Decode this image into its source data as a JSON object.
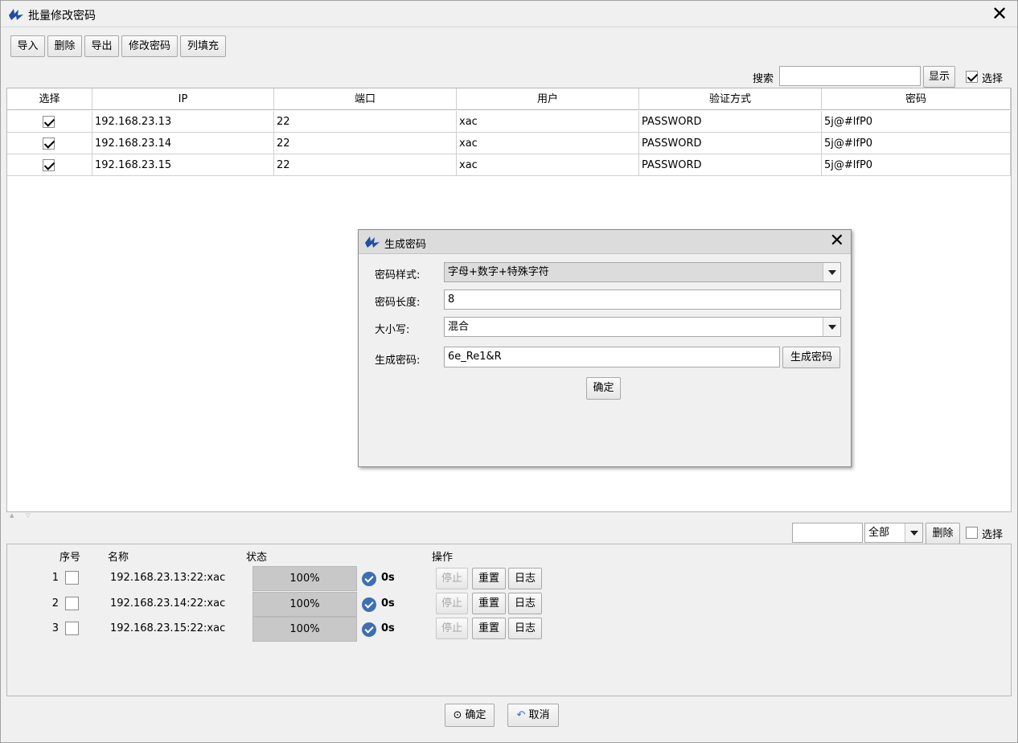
{
  "window": {
    "title": "批量修改密码"
  },
  "toolbar": {
    "import": "导入",
    "delete": "删除",
    "export": "导出",
    "change_password": "修改密码",
    "fill_column": "列填充"
  },
  "search": {
    "label": "搜索",
    "value": "",
    "show_button": "显示",
    "select_label": "选择",
    "select_checked": true
  },
  "table": {
    "headers": [
      "选择",
      "IP",
      "端口",
      "用户",
      "验证方式",
      "密码"
    ],
    "rows": [
      {
        "checked": true,
        "ip": "192.168.23.13",
        "port": "22",
        "user": "xac",
        "auth": "PASSWORD",
        "password": "5j@#lfP0"
      },
      {
        "checked": true,
        "ip": "192.168.23.14",
        "port": "22",
        "user": "xac",
        "auth": "PASSWORD",
        "password": "5j@#lfP0"
      },
      {
        "checked": true,
        "ip": "192.168.23.15",
        "port": "22",
        "user": "xac",
        "auth": "PASSWORD",
        "password": "5j@#lfP0"
      }
    ]
  },
  "task_filter": {
    "input_value": "",
    "filter_value": "全部",
    "delete_button": "删除",
    "select_label": "选择"
  },
  "tasks": {
    "headers": {
      "index": "序号",
      "name": "名称",
      "status": "状态",
      "action": "操作"
    },
    "rows": [
      {
        "index": "1",
        "name": "192.168.23.13:22:xac",
        "progress": "100%",
        "time": "0s",
        "stop": "停止",
        "reset": "重置",
        "log": "日志"
      },
      {
        "index": "2",
        "name": "192.168.23.14:22:xac",
        "progress": "100%",
        "time": "0s",
        "stop": "停止",
        "reset": "重置",
        "log": "日志"
      },
      {
        "index": "3",
        "name": "192.168.23.15:22:xac",
        "progress": "100%",
        "time": "0s",
        "stop": "停止",
        "reset": "重置",
        "log": "日志"
      }
    ]
  },
  "footer": {
    "ok": "确定",
    "cancel": "取消"
  },
  "dialog": {
    "title": "生成密码",
    "style_label": "密码样式:",
    "style_value": "字母+数字+特殊字符",
    "length_label": "密码长度:",
    "length_value": "8",
    "case_label": "大小写:",
    "case_value": "混合",
    "generated_label": "生成密码:",
    "generated_value": "6e_Re1&R",
    "generate_button": "生成密码",
    "confirm_button": "确定"
  },
  "colors": {
    "accent": "#3e6fb0",
    "logo_blue": "#1f4fa0",
    "progress_fill": "#c8c8c8"
  }
}
